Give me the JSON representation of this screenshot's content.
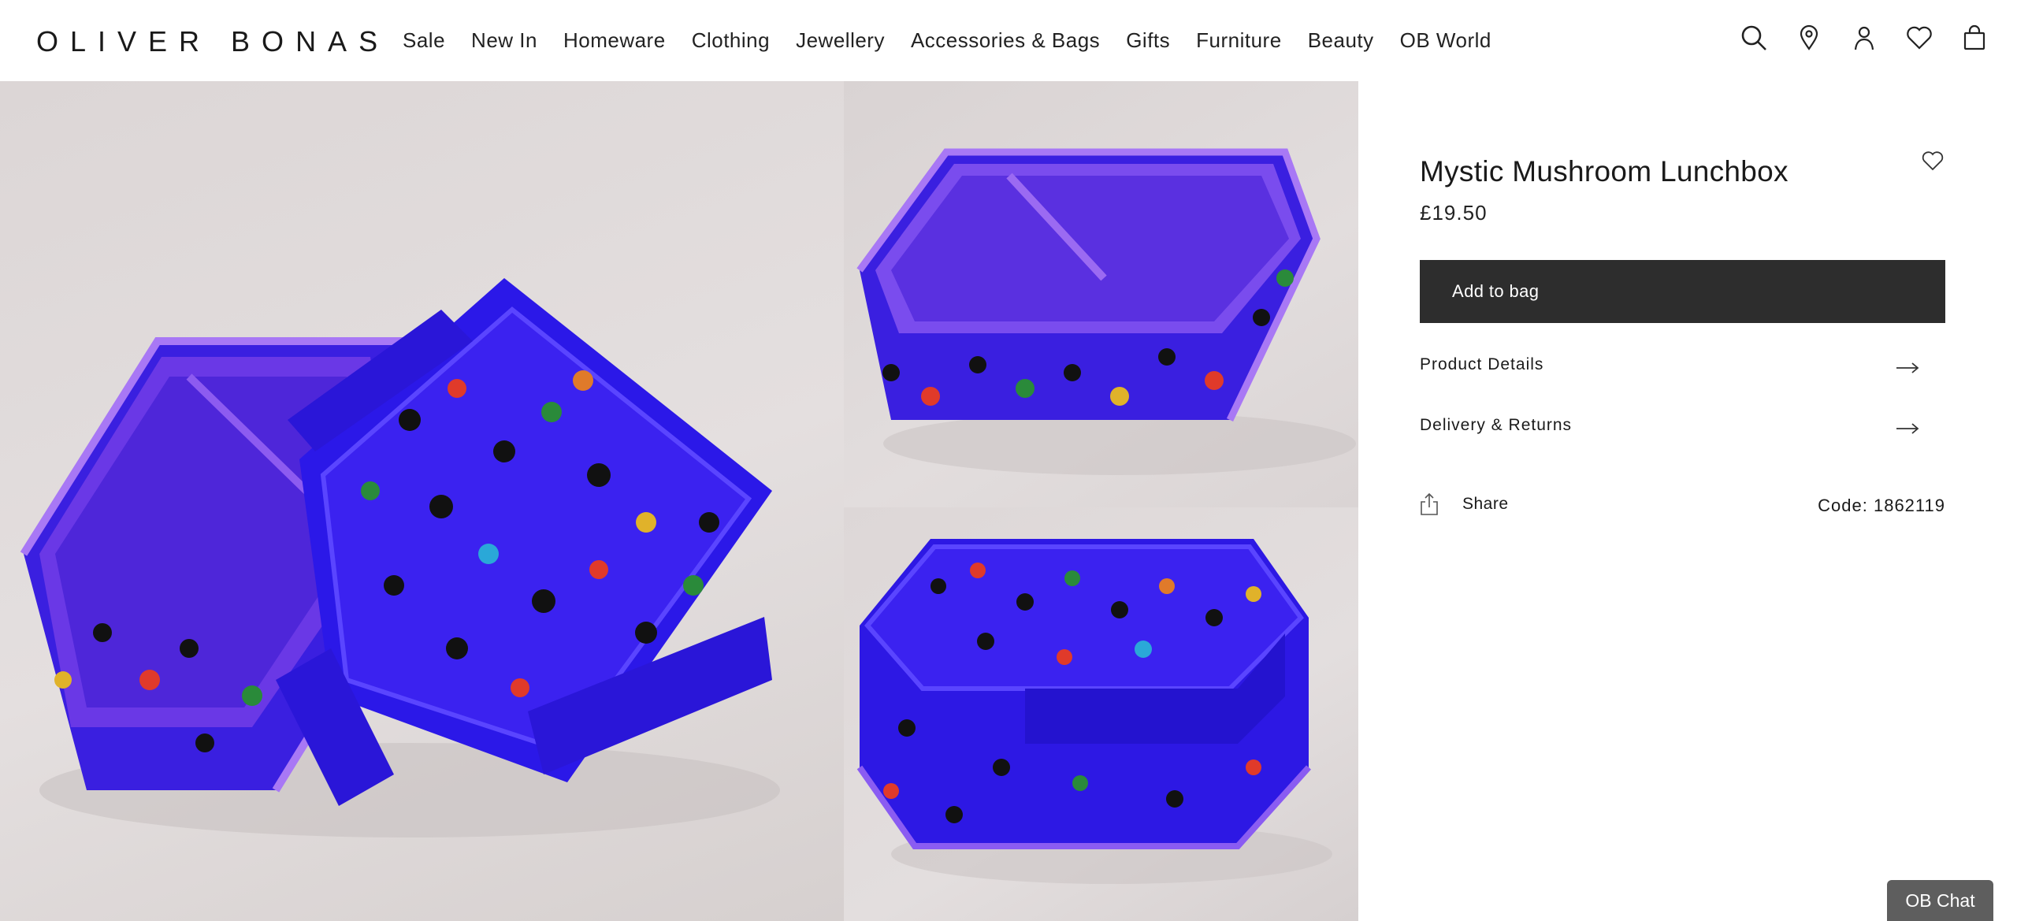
{
  "brand": {
    "logo_text": "OLIVER BONAS"
  },
  "nav": {
    "items": [
      {
        "label": "Sale"
      },
      {
        "label": "New In"
      },
      {
        "label": "Homeware"
      },
      {
        "label": "Clothing"
      },
      {
        "label": "Jewellery"
      },
      {
        "label": "Accessories & Bags"
      },
      {
        "label": "Gifts"
      },
      {
        "label": "Furniture"
      },
      {
        "label": "Beauty"
      },
      {
        "label": "OB World"
      }
    ]
  },
  "header_icons": [
    "search-icon",
    "store-locator-icon",
    "account-icon",
    "wishlist-icon",
    "bag-icon"
  ],
  "product": {
    "title": "Mystic Mushroom Lunchbox",
    "price": "£19.50",
    "add_to_bag_label": "Add to bag",
    "accordions": [
      {
        "label": "Product Details"
      },
      {
        "label": "Delivery & Returns"
      }
    ],
    "share_label": "Share",
    "code": "Code: 1862119"
  },
  "chat": {
    "label": "OB Chat"
  },
  "colors": {
    "button_bg": "#2d2d2d",
    "chat_bg": "#5e5e5e",
    "lunchbox_blue": "#3a1fe0",
    "lunchbox_purple": "#8a4ef0"
  }
}
